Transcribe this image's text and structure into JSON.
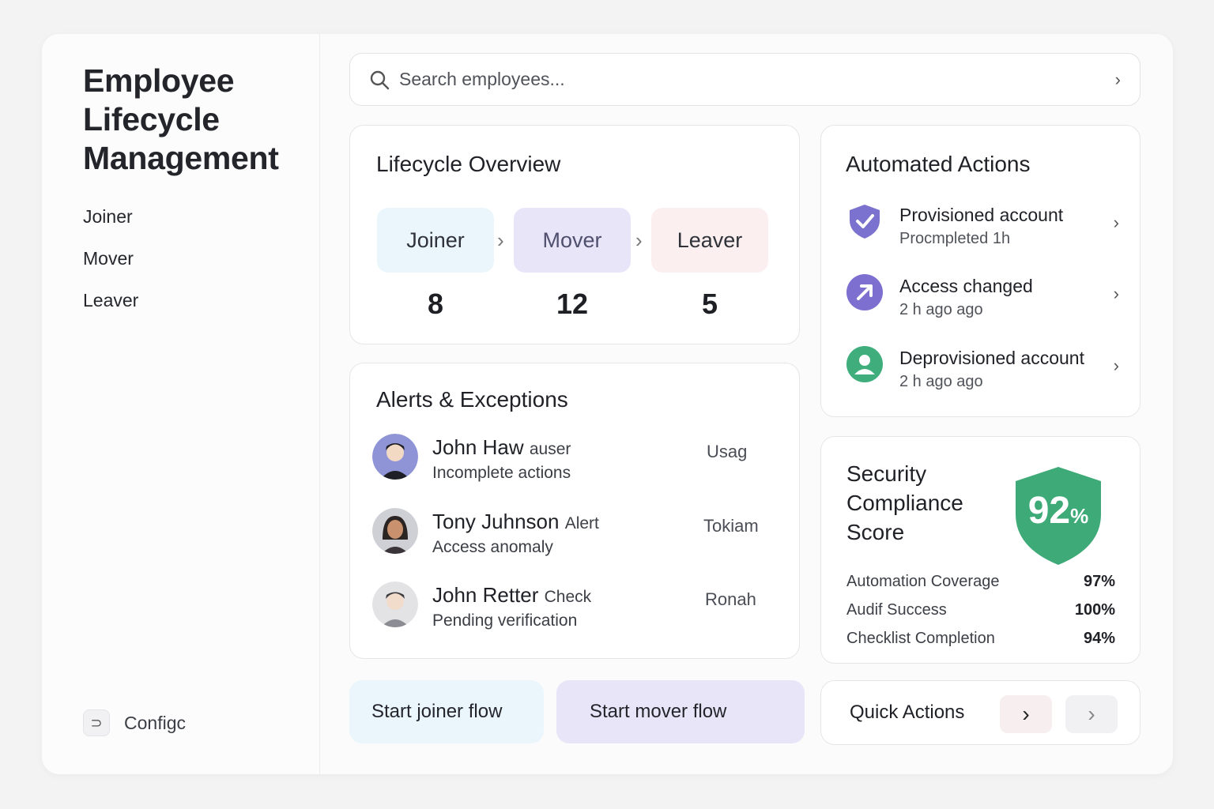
{
  "app": {
    "title": "Employee Lifecycle Management"
  },
  "sidebar": {
    "items": [
      {
        "label": "Joiner"
      },
      {
        "label": "Mover"
      },
      {
        "label": "Leaver"
      }
    ],
    "config_label": "Configc"
  },
  "search": {
    "placeholder": "Search employees..."
  },
  "lifecycle": {
    "title": "Lifecycle Overview",
    "stages": [
      {
        "label": "Joiner",
        "count": "8",
        "color": "#ebf6fc"
      },
      {
        "label": "Mover",
        "count": "12",
        "color": "#e8e5f8"
      },
      {
        "label": "Leaver",
        "count": "5",
        "color": "#fbefef"
      }
    ]
  },
  "alerts": {
    "title": "Alerts & Exceptions",
    "items": [
      {
        "name": "John Haw",
        "tag": "auser",
        "detail": "Incomplete actions",
        "right": "Usag"
      },
      {
        "name": "Tony Juhnson",
        "tag": "Alert",
        "detail": "Access anomaly",
        "right": "Tokiam"
      },
      {
        "name": "John Retter",
        "tag": "Check",
        "detail": "Pending verification",
        "right": "Ronah"
      }
    ]
  },
  "automated": {
    "title": "Automated Actions",
    "items": [
      {
        "title": "Provisioned account",
        "sub": "Procmpleted 1h",
        "icon": "shield-check-icon",
        "color": "#7b72cf"
      },
      {
        "title": "Access changed",
        "sub": "2 h ago ago",
        "icon": "arrow-up-right-icon",
        "color": "#7d6fd0"
      },
      {
        "title": "Deprovisioned account",
        "sub": "2 h ago ago",
        "icon": "user-icon",
        "color": "#3fae7c"
      }
    ]
  },
  "security": {
    "title": "Security Compliance Score",
    "score": "92",
    "score_unit": "%",
    "badge_color": "#3daa78",
    "metrics": [
      {
        "label": "Automation Coverage",
        "value": "97%"
      },
      {
        "label": "Audif Success",
        "value": "100%"
      },
      {
        "label": "Checklist Completion",
        "value": "94%"
      }
    ]
  },
  "footer": {
    "start_joiner": "Start joiner flow",
    "start_mover": "Start mover flow",
    "quick_actions": "Quick Actions"
  }
}
